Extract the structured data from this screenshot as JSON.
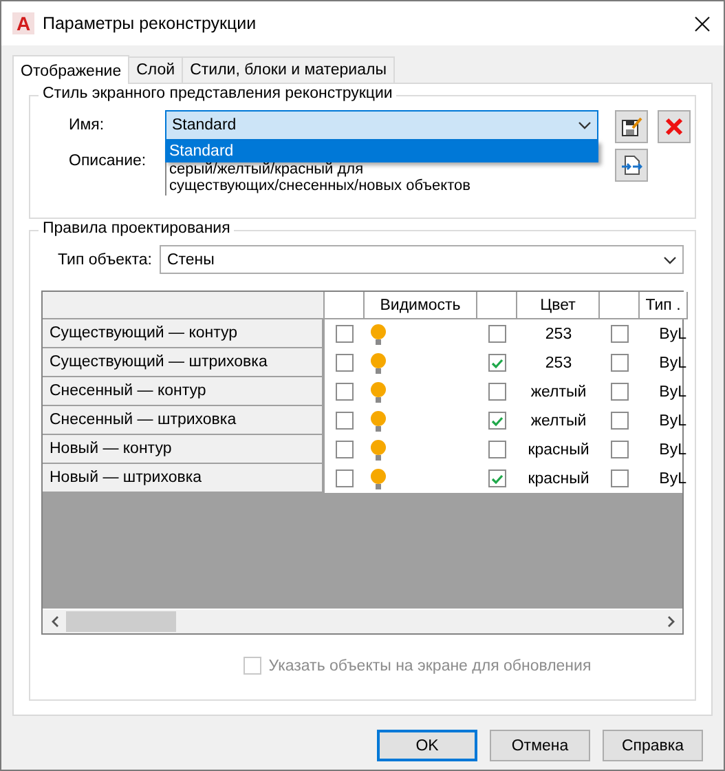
{
  "window": {
    "logo": "A",
    "title": "Параметры реконструкции"
  },
  "tabs": [
    {
      "label": "Отображение",
      "selected": true
    },
    {
      "label": "Слой",
      "selected": false
    },
    {
      "label": "Стили, блоки и материалы",
      "selected": false
    }
  ],
  "style_group": {
    "title": "Стиль экранного представления реконструкции",
    "name_label": "Имя:",
    "name_value": "Standard",
    "dropdown_open": true,
    "dropdown_items": [
      {
        "label": "Standard",
        "selected": true
      }
    ],
    "description_label": "Описание:",
    "description_lines": [
      "серый/желтый/красный для",
      "существующих/снесенных/новых объектов"
    ]
  },
  "rules_group": {
    "title": "Правила проектирования",
    "object_type_label": "Тип объекта:",
    "object_type_value": "Стены",
    "table": {
      "columns": [
        "Видимость",
        "Цвет",
        "Тип ."
      ],
      "rows": [
        {
          "name": "Существующий — контур",
          "visibility_checked": false,
          "light_on": true,
          "color_checked": false,
          "color_name": "253",
          "linetype_checked": false,
          "linetype": "ByL"
        },
        {
          "name": "Существующий — штриховка",
          "visibility_checked": false,
          "light_on": true,
          "color_checked": true,
          "color_name": "253",
          "linetype_checked": false,
          "linetype": "ByL"
        },
        {
          "name": "Снесенный — контур",
          "visibility_checked": false,
          "light_on": true,
          "color_checked": false,
          "color_name": "желтый",
          "linetype_checked": false,
          "linetype": "ByL"
        },
        {
          "name": "Снесенный — штриховка",
          "visibility_checked": false,
          "light_on": true,
          "color_checked": true,
          "color_name": "желтый",
          "linetype_checked": false,
          "linetype": "ByL"
        },
        {
          "name": "Новый — контур",
          "visibility_checked": false,
          "light_on": true,
          "color_checked": false,
          "color_name": "красный",
          "linetype_checked": false,
          "linetype": "ByL"
        },
        {
          "name": "Новый — штриховка",
          "visibility_checked": false,
          "light_on": true,
          "color_checked": true,
          "color_name": "красный",
          "linetype_checked": false,
          "linetype": "ByL"
        }
      ]
    },
    "select_on_screen": {
      "label": "Указать объекты на экране для обновления",
      "checked": false,
      "disabled": true
    }
  },
  "buttons": [
    {
      "label": "OK",
      "default": true
    },
    {
      "label": "Отмена",
      "default": false
    },
    {
      "label": "Справка",
      "default": false
    }
  ]
}
